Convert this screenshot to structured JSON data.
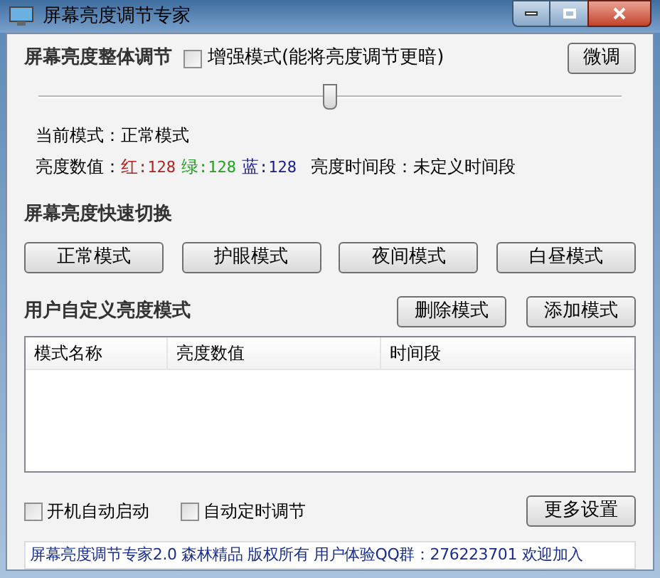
{
  "window": {
    "title": "屏幕亮度调节专家"
  },
  "overall": {
    "heading": "屏幕亮度整体调节",
    "enhance": {
      "label": "增强模式(能将亮度调节更暗)",
      "checked": false
    },
    "fine_button": "微调",
    "slider": {
      "level": 0.5
    }
  },
  "current_mode": {
    "label": "当前模式：",
    "value": "正常模式"
  },
  "brightness": {
    "label": "亮度数值：",
    "channels": [
      {
        "name": "红",
        "value": ":128",
        "color": "#b22222"
      },
      {
        "name": "绿",
        "value": ":128",
        "color": "#22a022"
      },
      {
        "name": "蓝",
        "value": ":128",
        "color": "#1a1a8c"
      }
    ],
    "period_label": "亮度时间段：",
    "period_value": "未定义时间段"
  },
  "quick": {
    "heading": "屏幕亮度快速切换",
    "buttons": [
      "正常模式",
      "护眼模式",
      "夜间模式",
      "白昼模式"
    ]
  },
  "custom": {
    "heading": "用户自定义亮度模式",
    "buttons": [
      "删除模式",
      "添加模式"
    ],
    "table": {
      "columns": [
        "模式名称",
        "亮度数值",
        "时间段"
      ]
    }
  },
  "options": [
    {
      "label": "开机自动启动",
      "checked": false
    },
    {
      "label": "自动定时调节",
      "checked": false
    }
  ],
  "more_button": "更多设置",
  "status_bar": "屏幕亮度调节专家2.0 森林精品 版权所有 用户体验QQ群：276223701 欢迎加入"
}
